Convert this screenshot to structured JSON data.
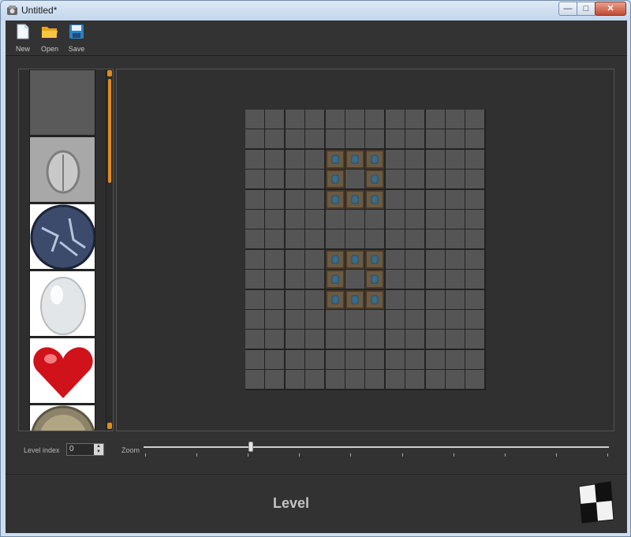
{
  "window": {
    "title": "Untitled*",
    "controls": {
      "minimize": "—",
      "maximize": "□",
      "close": "✕"
    }
  },
  "toolbar": {
    "items": [
      {
        "label": "New",
        "icon": "new-document-icon"
      },
      {
        "label": "Open",
        "icon": "open-folder-icon"
      },
      {
        "label": "Save",
        "icon": "save-disk-icon"
      }
    ]
  },
  "tile_palette": {
    "tiles": [
      {
        "name": "tile-empty",
        "icon": "empty-tile"
      },
      {
        "name": "tile-scarab",
        "icon": "stone-scarab-icon"
      },
      {
        "name": "tile-sphere",
        "icon": "blue-stone-sphere-icon"
      },
      {
        "name": "tile-egg",
        "icon": "white-egg-icon"
      },
      {
        "name": "tile-heart",
        "icon": "red-heart-icon"
      },
      {
        "name": "tile-coin",
        "icon": "gold-coin-icon"
      }
    ],
    "scroll_position": 0.0
  },
  "level_grid": {
    "rows": 14,
    "cols": 12,
    "filled_tile": "blue-idol-tile",
    "filled_cells": [
      [
        2,
        4
      ],
      [
        2,
        5
      ],
      [
        2,
        6
      ],
      [
        3,
        4
      ],
      [
        3,
        6
      ],
      [
        4,
        4
      ],
      [
        4,
        5
      ],
      [
        4,
        6
      ],
      [
        7,
        4
      ],
      [
        7,
        5
      ],
      [
        7,
        6
      ],
      [
        8,
        4
      ],
      [
        8,
        6
      ],
      [
        9,
        4
      ],
      [
        9,
        5
      ],
      [
        9,
        6
      ]
    ]
  },
  "level_index": {
    "label": "Level index",
    "value": "0"
  },
  "zoom": {
    "label": "Zoom",
    "value_fraction": 0.23,
    "tick_count": 10
  },
  "footer": {
    "heading": "Level",
    "logo": "checkered-logo-icon"
  },
  "colors": {
    "accent": "#e08a1e",
    "background": "#323232",
    "cell": "#555555"
  }
}
